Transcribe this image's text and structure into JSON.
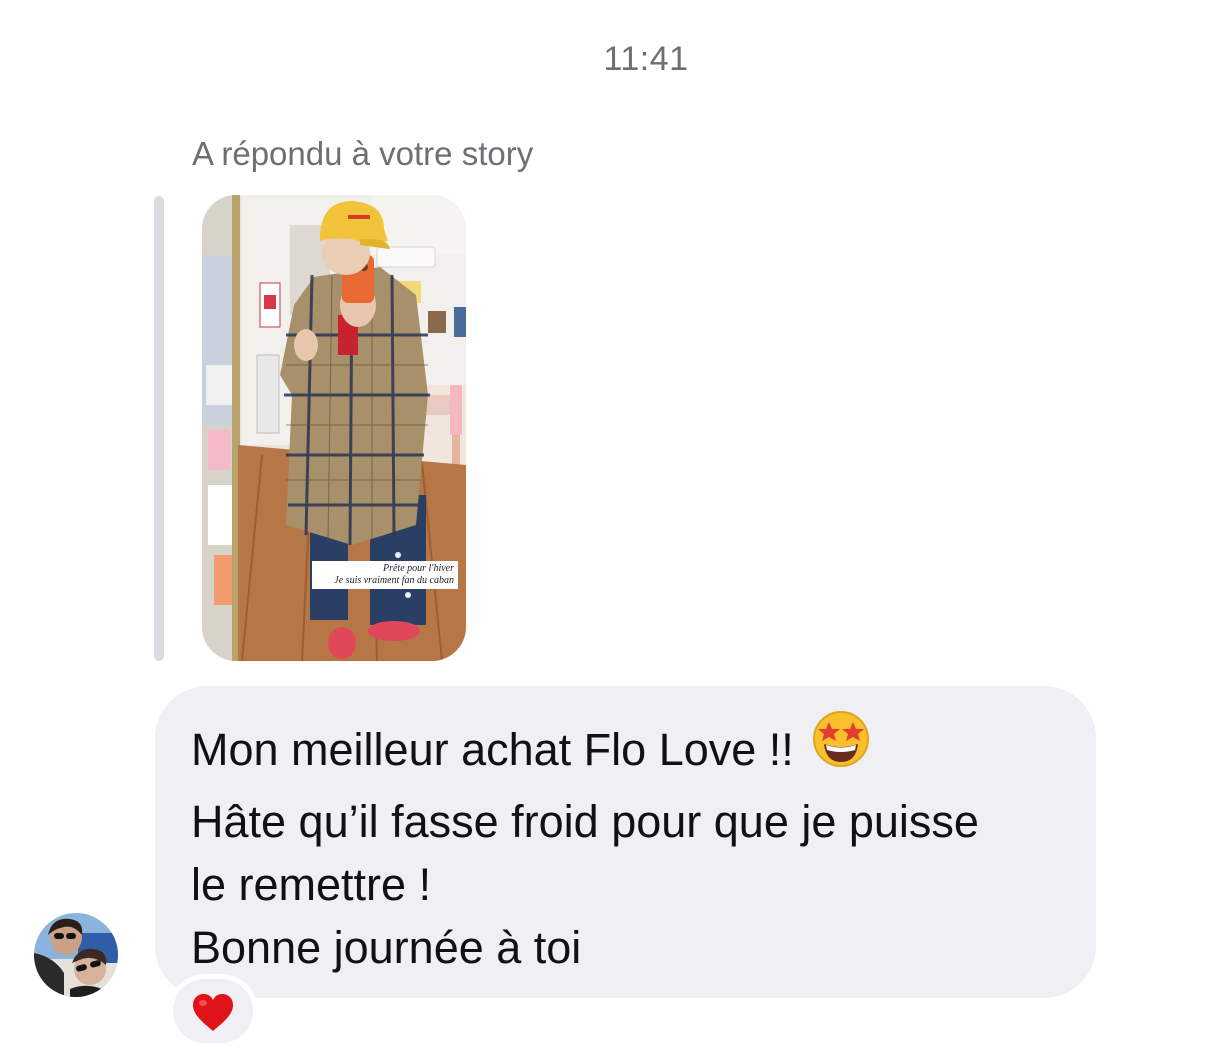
{
  "timestamp": "11:41",
  "reply_label": "A répondu à votre story",
  "story": {
    "caption_line1": "Prête pour l'hiver",
    "caption_line2": "Je suis vraiment fan du caban"
  },
  "message": {
    "line1": "Mon meilleur achat Flo Love !!",
    "line1_emoji": "star-struck-emoji",
    "line2": "Hâte qu’il fasse froid pour que je puisse",
    "line3": "le remettre !",
    "line4": "Bonne journée à toi"
  },
  "reaction": {
    "icon": "red-heart-icon",
    "color": "#e0131a"
  },
  "colors": {
    "bubble": "#efeff4",
    "secondary_text": "#6e6e73",
    "reply_bar": "#dbdbdf"
  }
}
